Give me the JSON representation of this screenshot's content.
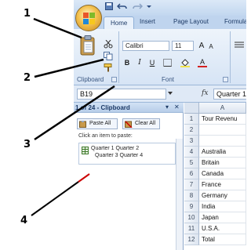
{
  "callouts": [
    "1",
    "2",
    "3",
    "4"
  ],
  "ribbon_tabs": [
    "Home",
    "Insert",
    "Page Layout",
    "Formula"
  ],
  "font_group": {
    "font_name": "Calibri",
    "font_size": "11",
    "grow_label": "A",
    "shrink_label": "A",
    "bold": "B",
    "italic": "I",
    "underline": "U",
    "label": "Font"
  },
  "clipboard_group": {
    "label": "Clipboard"
  },
  "formula_bar": {
    "name_box": "B19",
    "fx": "fx",
    "value": "Quarter 1"
  },
  "clipboard_pane": {
    "title": "1 of 24 - Clipboard",
    "paste_all": "Paste All",
    "clear_all": "Clear All",
    "hint": "Click an item to paste:",
    "item_line1": "Quarter 1 Quarter 2",
    "item_line2": "Quarter 3 Quarter 4"
  },
  "sheet": {
    "column": "A",
    "rows": [
      {
        "num": "1",
        "value": "Tour Revenu"
      },
      {
        "num": "2",
        "value": ""
      },
      {
        "num": "3",
        "value": ""
      },
      {
        "num": "4",
        "value": "Australia"
      },
      {
        "num": "5",
        "value": "Britain"
      },
      {
        "num": "6",
        "value": "Canada"
      },
      {
        "num": "7",
        "value": "France"
      },
      {
        "num": "8",
        "value": "Germany"
      },
      {
        "num": "9",
        "value": "India"
      },
      {
        "num": "10",
        "value": "Japan"
      },
      {
        "num": "11",
        "value": "U.S.A."
      },
      {
        "num": "12",
        "value": "Total"
      }
    ]
  },
  "colors": {
    "ribbon": "#dbe8f7",
    "arrow_tip": "#cc0000"
  }
}
